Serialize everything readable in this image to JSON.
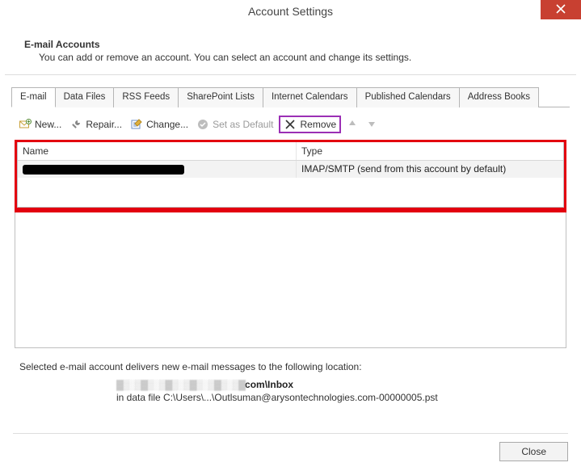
{
  "window": {
    "title": "Account Settings"
  },
  "intro": {
    "heading": "E-mail Accounts",
    "text": "You can add or remove an account. You can select an account and change its settings."
  },
  "tabs": {
    "items": [
      {
        "label": "E-mail"
      },
      {
        "label": "Data Files"
      },
      {
        "label": "RSS Feeds"
      },
      {
        "label": "SharePoint Lists"
      },
      {
        "label": "Internet Calendars"
      },
      {
        "label": "Published Calendars"
      },
      {
        "label": "Address Books"
      }
    ],
    "active": 0
  },
  "toolbar": {
    "new": "New...",
    "repair": "Repair...",
    "change": "Change...",
    "set_default": "Set as Default",
    "remove": "Remove"
  },
  "list": {
    "columns": {
      "name": "Name",
      "type": "Type"
    },
    "rows": [
      {
        "name_redacted": true,
        "type": "IMAP/SMTP (send from this account by default)"
      }
    ]
  },
  "selected_caption": "Selected e-mail account delivers new e-mail messages to the following location:",
  "location": {
    "line1_suffix": "com\\Inbox",
    "line2": "in data file C:\\Users\\...\\Outlsuman@arysontechnologies.com-00000005.pst"
  },
  "footer": {
    "close": "Close"
  }
}
